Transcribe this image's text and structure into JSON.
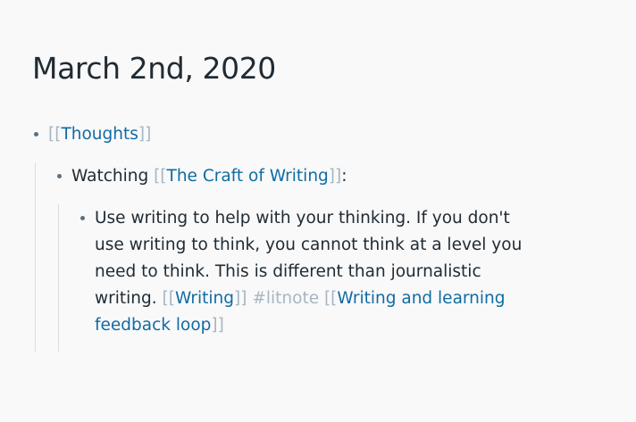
{
  "page": {
    "title": "March 2nd, 2020"
  },
  "blocks": [
    {
      "ref": "Thoughts"
    },
    {
      "prefix": "Watching ",
      "ref": "The Craft of Writing",
      "suffix": ":"
    },
    {
      "text": "Use writing to help with your thinking. If you don't use writing to think, you cannot think at a level you need to think. This is different than journalistic writing.",
      "ref1": "Writing",
      "tag": "#litnote",
      "ref2": "Writing and learning feedback loop"
    }
  ],
  "brackets": {
    "open": "[[",
    "close": "]]"
  }
}
